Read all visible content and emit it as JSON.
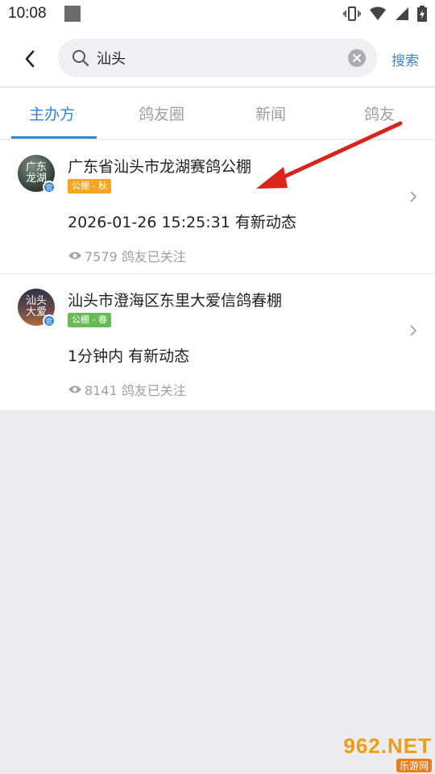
{
  "status_bar": {
    "time": "10:08"
  },
  "search": {
    "query": "汕头",
    "button_label": "搜索"
  },
  "tabs": [
    {
      "label": "主办方",
      "active": true
    },
    {
      "label": "鸽友圈",
      "active": false
    },
    {
      "label": "新闻",
      "active": false
    },
    {
      "label": "鸽友",
      "active": false
    }
  ],
  "results": [
    {
      "name": "广东省汕头市龙湖赛鸽公棚",
      "avatar_text": "广东龙湖",
      "official_badge": "官",
      "tag": "公棚 - 秋",
      "tag_color": "#f5a623",
      "update": "2026-01-26 15:25:31 有新动态",
      "followers": "7579 鸽友已关注"
    },
    {
      "name": "汕头市澄海区东里大爱信鸽春棚",
      "avatar_text": "汕头大爱",
      "official_badge": "官",
      "tag": "公棚 - 春",
      "tag_color": "#66bb55",
      "update": "1分钟内 有新动态",
      "followers": "8141 鸽友已关注"
    }
  ],
  "watermark": {
    "brand": "962.NET",
    "sub": "乐游网"
  },
  "colors": {
    "accent": "#2f86d6",
    "annotation_arrow": "#d9241c"
  }
}
